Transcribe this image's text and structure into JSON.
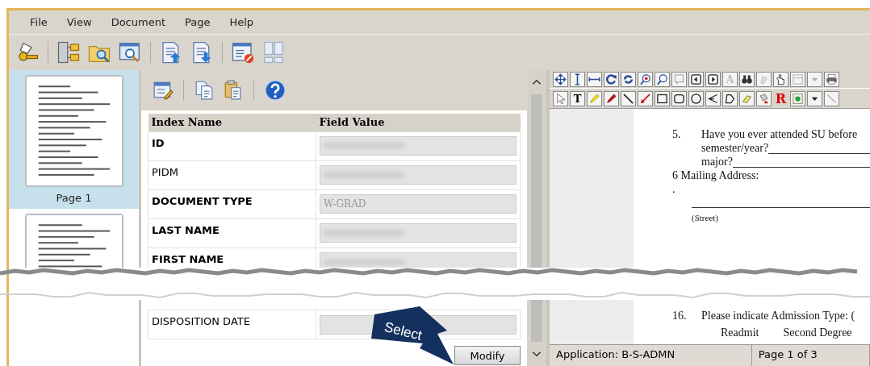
{
  "menu_bar": [
    "File",
    "View",
    "Document",
    "Page",
    "Help"
  ],
  "thumbnails": [
    {
      "label": "Page 1",
      "selected": true
    },
    {
      "selected": false
    }
  ],
  "index_table": {
    "columns": [
      "Index Name",
      "Field Value"
    ],
    "upper_rows": [
      {
        "name": "ID",
        "required": true,
        "redacted": true
      },
      {
        "name": "PIDM",
        "required": false,
        "redacted": true
      },
      {
        "name": "DOCUMENT TYPE",
        "required": true,
        "redacted": false,
        "value": "W-GRAD"
      },
      {
        "name": "LAST NAME",
        "required": true,
        "redacted": true
      },
      {
        "name": "FIRST NAME",
        "required": true,
        "redacted": true
      }
    ],
    "lower_rows": [
      {
        "name": "DISPOSITION DATE",
        "required": false,
        "redacted": false
      }
    ]
  },
  "modify_button": "Modify",
  "callout": "Select",
  "viewer_toolbar": {
    "text_glyph": "A"
  },
  "annotation_toolbar": {
    "text_glyph": "T",
    "redact_glyph": "R"
  },
  "document": {
    "upper_lines": [
      {
        "kind": "numbered",
        "number": "5.",
        "text": "Have you ever attended SU before"
      },
      {
        "kind": "blank",
        "text": "semester/year?"
      },
      {
        "kind": "blank",
        "text": "major?"
      },
      {
        "kind": "plain",
        "text": "6 Mailing Address:"
      },
      {
        "kind": "plain",
        "text": "."
      },
      {
        "kind": "rule"
      },
      {
        "kind": "caption",
        "text": "(Street)"
      }
    ],
    "lower_lines": [
      {
        "kind": "numbered",
        "number": "16.",
        "text": "Please indicate Admission Type: ("
      },
      {
        "kind": "options",
        "items": [
          "Readmit",
          "Second Degree"
        ]
      }
    ]
  },
  "status_bar": [
    "Application: B-S-ADMN",
    "Page 1 of 3"
  ]
}
